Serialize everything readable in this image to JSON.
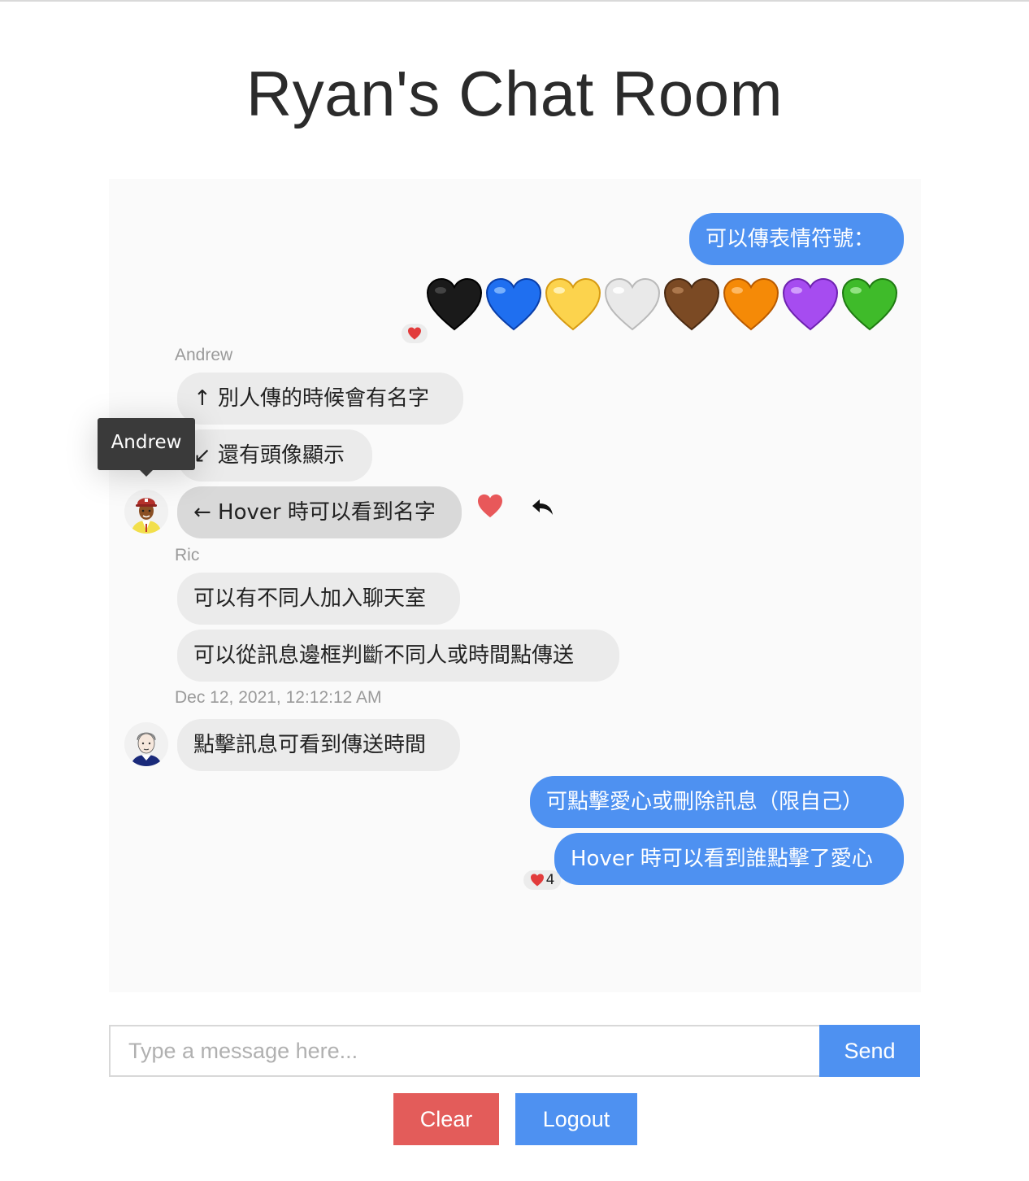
{
  "title": "Ryan's Chat Room",
  "messages": {
    "m1": "可以傳表情符號：",
    "emoji_hearts": [
      "black",
      "blue",
      "yellow",
      "white",
      "brown",
      "orange",
      "purple",
      "green"
    ],
    "sender_andrew": "Andrew",
    "m2": "↑ 別人傳的時候會有名字",
    "m3": "↙ 還有頭像顯示",
    "m4": "← Hover 時可以看到名字",
    "sender_ric": "Ric",
    "m5": "可以有不同人加入聊天室",
    "m6": "可以從訊息邊框判斷不同人或時間點傳送",
    "timestamp": "Dec 12, 2021, 12:12:12 AM",
    "m7": "點擊訊息可看到傳送時間",
    "m8": "可點擊愛心或刪除訊息（限自己）",
    "m9": "Hover 時可以看到誰點擊了愛心",
    "m9_reaction_count": "4"
  },
  "tooltip": "Andrew",
  "input": {
    "placeholder": "Type a message here...",
    "send_label": "Send"
  },
  "buttons": {
    "clear_label": "Clear",
    "logout_label": "Logout"
  },
  "colors": {
    "mine_bubble": "#4e91f1",
    "theirs_bubble": "#ebebeb",
    "clear": "#e35c5a",
    "heart": "#e23b3b"
  }
}
